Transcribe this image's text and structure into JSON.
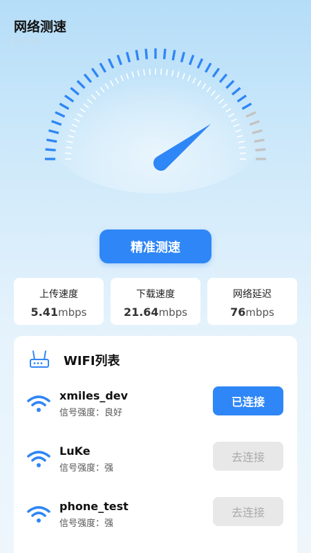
{
  "app": {
    "title": "网络测速",
    "version": "17613b"
  },
  "gauge": {
    "needle_fraction": 0.82,
    "colors": {
      "active": "#2f86f6",
      "inactive": "#c4c4c4",
      "inner": "#ffffff",
      "needle": "#2f86f6"
    }
  },
  "actions": {
    "precise_test_label": "精准测速"
  },
  "stats": [
    {
      "label": "上传速度",
      "value": "5.41",
      "unit": "mbps"
    },
    {
      "label": "下载速度",
      "value": "21.64",
      "unit": "mbps"
    },
    {
      "label": "网络延迟",
      "value": "76",
      "unit": "mbps"
    }
  ],
  "wifi": {
    "title": "WIFI列表",
    "items": [
      {
        "name": "xmiles_dev",
        "signal": "信号强度：良好",
        "button": "已连接",
        "connected": true
      },
      {
        "name": "LuKe",
        "signal": "信号强度：强",
        "button": "去连接",
        "connected": false
      },
      {
        "name": "phone_test",
        "signal": "信号强度：强",
        "button": "去连接",
        "connected": false
      }
    ]
  }
}
